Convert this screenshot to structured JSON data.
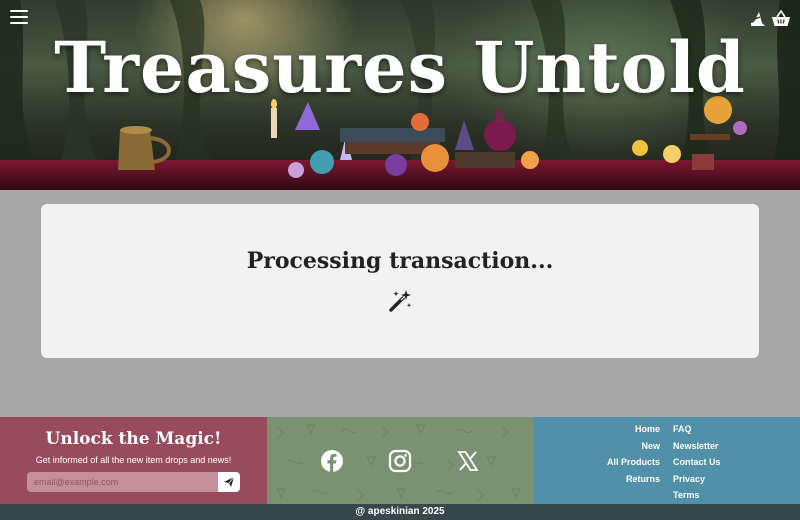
{
  "header": {
    "title": "Treasures Untold",
    "icons": {
      "menu": "hamburger-menu-icon",
      "hat": "witch-hat-icon",
      "cart": "shopping-basket-icon"
    }
  },
  "main": {
    "status_text": "Processing transaction...",
    "status_icon": "magic-wand-icon"
  },
  "footer": {
    "newsletter": {
      "title": "Unlock the Magic!",
      "subtitle": "Get informed of all the new item drops and news!",
      "email_placeholder": "email@example.com",
      "send_icon": "paper-plane-icon"
    },
    "social": [
      "facebook-icon",
      "instagram-icon",
      "x-icon"
    ],
    "links_left": [
      "Home",
      "New",
      "All Products",
      "Returns"
    ],
    "links_right": [
      "FAQ",
      "Newsletter",
      "Contact Us",
      "Privacy",
      "Terms"
    ],
    "copyright": "@ apeskinian 2025"
  },
  "colors": {
    "footer_left": "#984c5b",
    "footer_mid": "#7a9272",
    "footer_right": "#5090a9",
    "copyright_bar": "#38484a",
    "page_bg": "#a7a7a7",
    "card_bg": "#f2f2f2"
  }
}
